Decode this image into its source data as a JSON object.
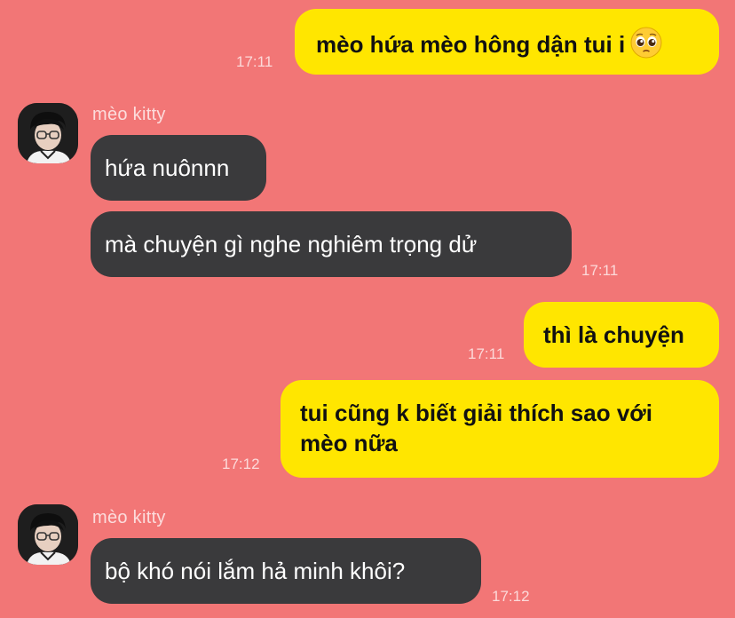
{
  "messages": [
    {
      "direction": "out",
      "text": "mèo hứa mèo hông dận tui i",
      "emoji": "pleading-face",
      "time": "17:11"
    },
    {
      "direction": "in",
      "sender": "mèo kitty",
      "text": "hứa nuônnn"
    },
    {
      "direction": "in",
      "text": "mà chuyện gì nghe nghiêm trọng dử",
      "time": "17:11"
    },
    {
      "direction": "out",
      "text": "thì là chuyện",
      "time": "17:11"
    },
    {
      "direction": "out",
      "text_line1": "tui cũng k biết giải thích sao với",
      "text_line2": "mèo nữa",
      "time": "17:12"
    },
    {
      "direction": "in",
      "sender": "mèo kitty",
      "text": "bộ khó nói lắm hả minh khôi?",
      "time": "17:12"
    }
  ],
  "colors": {
    "background": "#F27676",
    "outgoing_bubble": "#FFE600",
    "incoming_bubble": "#3A3A3C"
  }
}
